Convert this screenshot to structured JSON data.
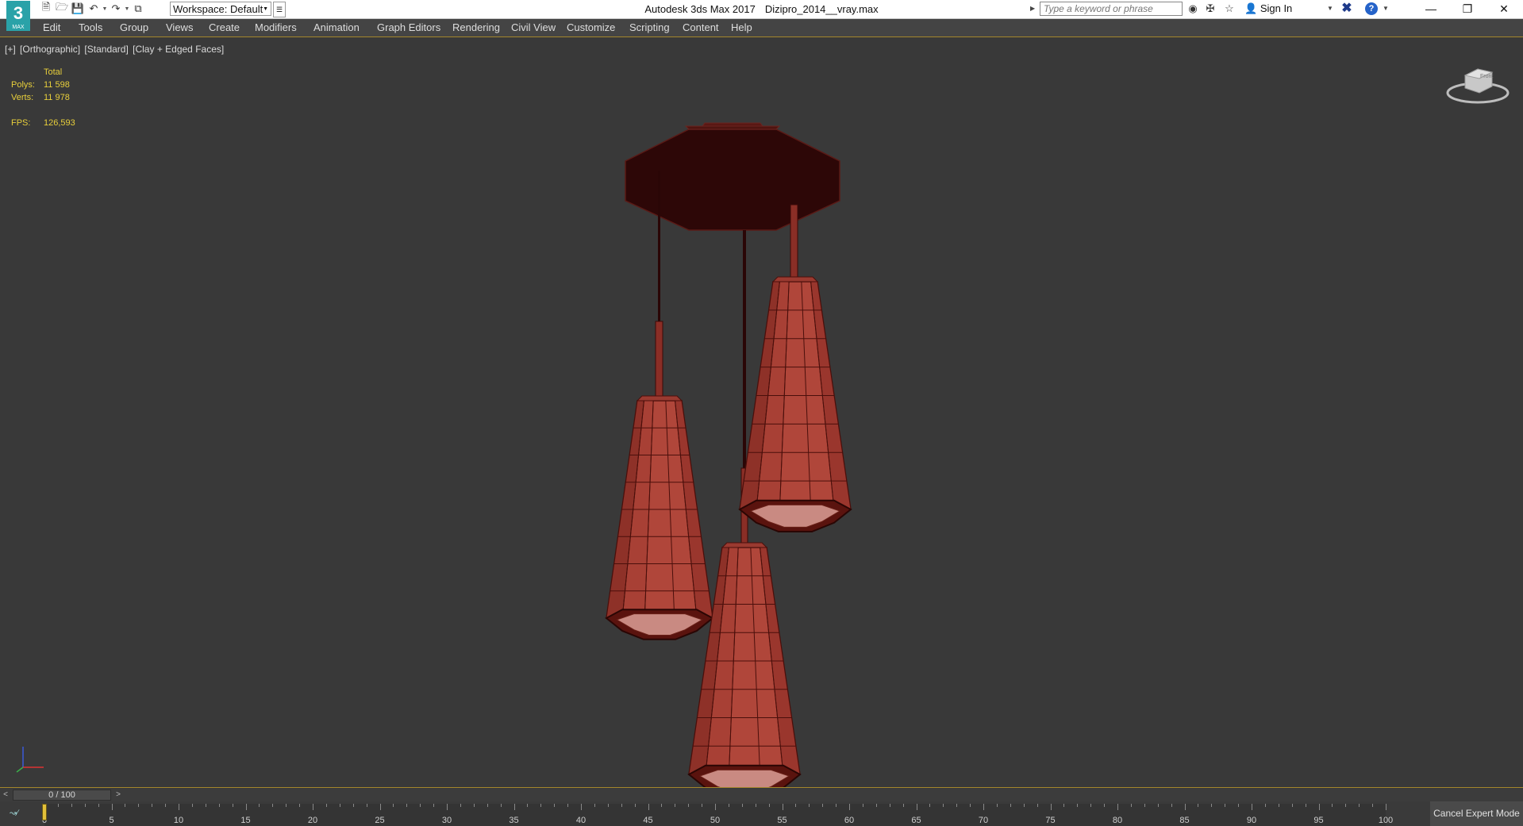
{
  "app": {
    "logo_text": "3",
    "logo_sub": "MAX",
    "title": "Autodesk 3ds Max 2017",
    "filename": "Dizipro_2014__vray.max"
  },
  "toolbar": {
    "workspace_label": "Workspace: Default",
    "search_placeholder": "Type a keyword or phrase",
    "sign_in": "Sign In"
  },
  "menu": [
    "Edit",
    "Tools",
    "Group",
    "Views",
    "Create",
    "Modifiers",
    "Animation",
    "Graph Editors",
    "Rendering",
    "Civil View",
    "Customize",
    "Scripting",
    "Content",
    "Help"
  ],
  "viewport": {
    "labels": [
      "[+]",
      "[Orthographic]",
      "[Standard]",
      "[Clay + Edged Faces]"
    ],
    "stats": {
      "header": "Total",
      "polys_label": "Polys:",
      "polys_value": "11 598",
      "verts_label": "Verts:",
      "verts_value": "11 978",
      "fps_label": "FPS:",
      "fps_value": "126,593"
    },
    "viewcube_label": "Front"
  },
  "timeline": {
    "slider_text": "0 / 100",
    "current_frame": 0,
    "ticks": [
      "0",
      "5",
      "10",
      "15",
      "20",
      "25",
      "30",
      "35",
      "40",
      "45",
      "50",
      "55",
      "60",
      "65",
      "70",
      "75",
      "80",
      "85",
      "90",
      "95",
      "100"
    ],
    "cancel_expert": "Cancel Expert Mode"
  },
  "colors": {
    "lamp_shade": "#b0463a",
    "canopy": "#2d0707",
    "stats_text": "#e8cf3b",
    "viewport_bg": "#393939",
    "viewport_border": "#a3872c"
  }
}
